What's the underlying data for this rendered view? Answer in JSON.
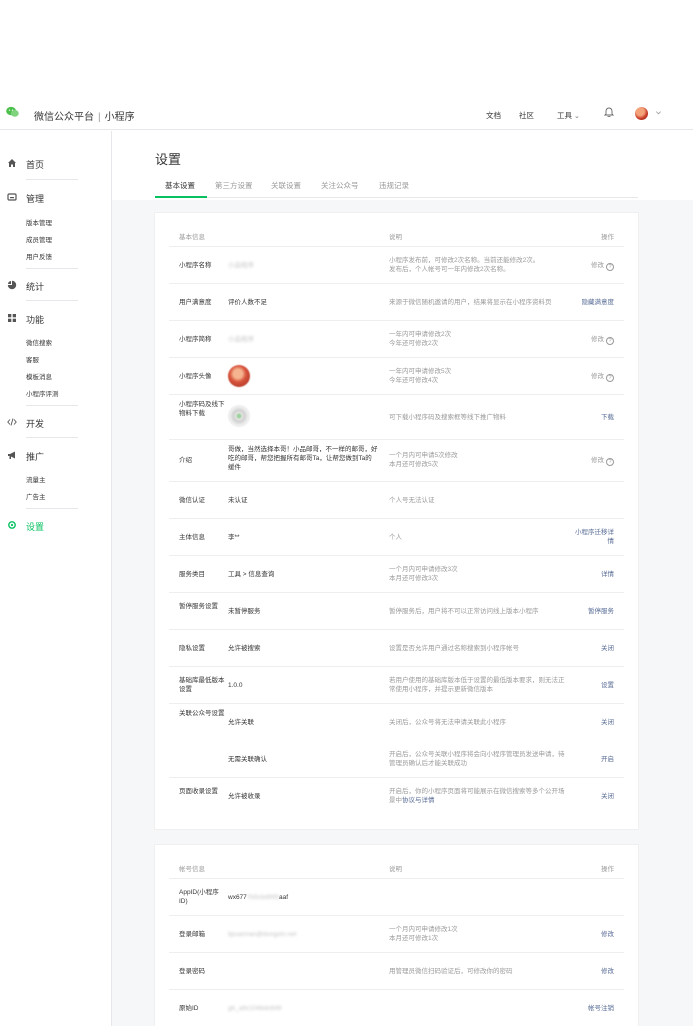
{
  "header": {
    "brand": "微信公众平台",
    "separator": "|",
    "product": "小程序",
    "nav": [
      "文档",
      "社区",
      "工具"
    ],
    "tools_chevron": "⌄"
  },
  "sidebar": {
    "sections": [
      {
        "title": "首页",
        "icon": "home-icon"
      },
      {
        "title": "管理",
        "icon": "management-icon",
        "items": [
          "版本管理",
          "成员管理",
          "用户反馈"
        ]
      },
      {
        "title": "统计",
        "icon": "stats-icon"
      },
      {
        "title": "功能",
        "icon": "features-icon",
        "items": [
          "微信搜索",
          "客服",
          "模板消息",
          "小程序评测"
        ]
      },
      {
        "title": "开发",
        "icon": "code-icon"
      },
      {
        "title": "推广",
        "icon": "megaphone-icon",
        "items": [
          "流量主",
          "广告主"
        ]
      },
      {
        "title": "设置",
        "icon": "gear-icon",
        "active": true
      }
    ]
  },
  "page": {
    "title": "设置",
    "tabs": [
      "基本设置",
      "第三方设置",
      "关联设置",
      "关注公众号",
      "违规记录"
    ]
  },
  "basic": {
    "header": {
      "label": "基本信息",
      "desc": "说明",
      "op": "操作"
    },
    "rows": [
      {
        "label": "小程序名称",
        "value": "小品程序",
        "desc": [
          "小程序发布前，可修改2次名称。当前还能修改2次。",
          "发布后，个人帐号可一年内修改2次名称。"
        ],
        "op": "修改"
      },
      {
        "label": "用户满意度",
        "value": "评价人数不足",
        "desc": [
          "来源于微信随机邀请的用户，结果将显示在小程序资料页"
        ],
        "op": "隐藏满意度"
      },
      {
        "label": "小程序简称",
        "value": "小品程序",
        "desc": [
          "一年内可申请修改2次",
          "今年还可修改2次"
        ],
        "op": "修改"
      },
      {
        "label": "小程序头像",
        "value": "",
        "desc": [
          "一年内可申请修改5次",
          "今年还可修改4次"
        ],
        "op": "修改"
      },
      {
        "label": "小程序码及线下物料下载",
        "value": "",
        "desc": [
          "可下载小程序码及搜索框等线下推广物料"
        ],
        "op": "下载"
      },
      {
        "label": "介绍",
        "value": "哥做，当然选择本哥！小品邮哥，不一样的邮哥，好吃的邮哥，帮您把握所有邮哥Ta，让帮您做到Ta的缓件",
        "desc": [
          "一个月内可申请5次修改",
          "本月还可修改5次"
        ],
        "op": "修改"
      },
      {
        "label": "微信认证",
        "value": "未认证",
        "desc": [
          "个人号无法认证"
        ],
        "op": ""
      },
      {
        "label": "主体信息",
        "value": "李**",
        "desc": [
          "个人"
        ],
        "op": "小程序迁移详情"
      },
      {
        "label": "服务类目",
        "value": "工具 > 信息查询",
        "desc": [
          "一个月内可申请修改3次",
          "本月还可修改3次"
        ],
        "op": "详情"
      },
      {
        "label": "暂停服务设置",
        "value": "未暂停服务",
        "desc": [
          "暂停服务后，用户将不可以正常访问线上版本小程序"
        ],
        "op": "暂停服务"
      },
      {
        "label": "隐私设置",
        "value": "允许被搜索",
        "desc": [
          "设置是否允许用户通过名称搜索到小程序帐号"
        ],
        "op": "关闭"
      },
      {
        "label": "基础库最低版本设置",
        "value": "1.0.0",
        "desc": [
          "若用户使用的基础库版本低于设置的最低版本要求，则无法正常使用小程序，并提示更新微信版本"
        ],
        "op": "设置"
      },
      {
        "label": "关联公众号设置",
        "value": "允许关联",
        "desc": [
          "关闭后，公众号将无法申请关联此小程序"
        ],
        "op": "关闭"
      },
      {
        "label": "",
        "value": "无需关联确认",
        "desc": [
          "开启后，公众号关联小程序将会向小程序管理员发送申请，待管理员确认后才能关联成功"
        ],
        "op": "开启"
      },
      {
        "label": "页面收录设置",
        "value": "允许被收录",
        "desc": [
          "开启后，你的小程序页面将可能展示在微信搜索等多个公开场景中"
        ],
        "desc_link": "协议与详情",
        "op": "关闭"
      }
    ]
  },
  "account": {
    "header": {
      "label": "帐号信息",
      "desc": "说明",
      "op": "操作"
    },
    "rows": [
      {
        "label": "AppID(小程序ID)",
        "value": "wx677",
        "value_blur": "7b5cbd995",
        "value_tail": "aaf",
        "desc": [],
        "op": ""
      },
      {
        "label": "登录邮箱",
        "value": "lipuannan@dongxin.net",
        "desc": [
          "一个月内可申请修改1次",
          "本月还可修改1次"
        ],
        "op": "修改"
      },
      {
        "label": "登录密码",
        "value": "",
        "desc": [
          "用管理员微信扫码验证后，可修改你的密码"
        ],
        "op": "修改"
      },
      {
        "label": "原始ID",
        "value": "gh_a9c104bdc649",
        "desc": [],
        "op": "帐号注销"
      }
    ]
  },
  "colors": {
    "accent": "#07c160",
    "link": "#576b95",
    "muted": "#9a9a9a",
    "text": "#353535"
  }
}
